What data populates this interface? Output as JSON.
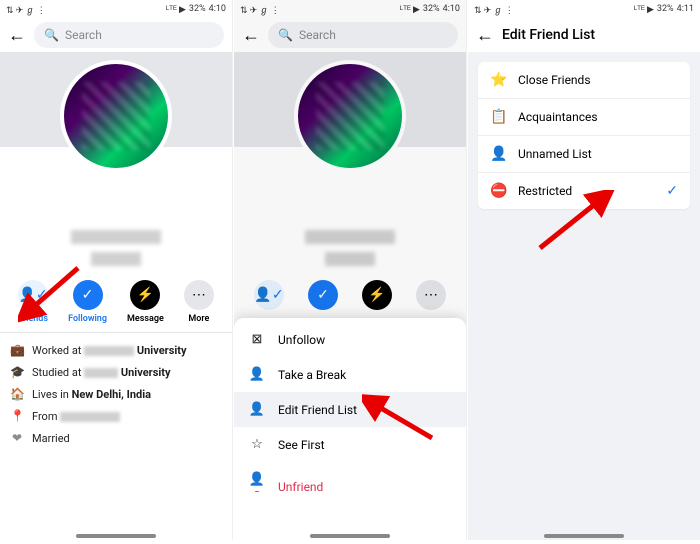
{
  "status": {
    "left_icons": "⇅ ✈ ℊ ⋮",
    "signal": "ᴸᵀᴱ ▶",
    "battery": "32%",
    "time1": "4:10",
    "time2": "4:10",
    "time3": "4:11"
  },
  "search": {
    "placeholder": "Search"
  },
  "actions": {
    "friends": "Friends",
    "following": "Following",
    "message": "Message",
    "more": "More"
  },
  "about": {
    "worked_prefix": "Worked at",
    "worked_suffix": "University",
    "studied_prefix": "Studied at",
    "studied_suffix": "University",
    "lives_prefix": "Lives in",
    "lives_value": "New Delhi, India",
    "from_prefix": "From",
    "married": "Married"
  },
  "sheet": {
    "unfollow": "Unfollow",
    "take_break": "Take a Break",
    "edit_list": "Edit Friend List",
    "see_first": "See First",
    "unfriend": "Unfriend"
  },
  "p3": {
    "title": "Edit Friend List",
    "close_friends": "Close Friends",
    "acquaintances": "Acquaintances",
    "unnamed": "Unnamed List",
    "restricted": "Restricted"
  }
}
